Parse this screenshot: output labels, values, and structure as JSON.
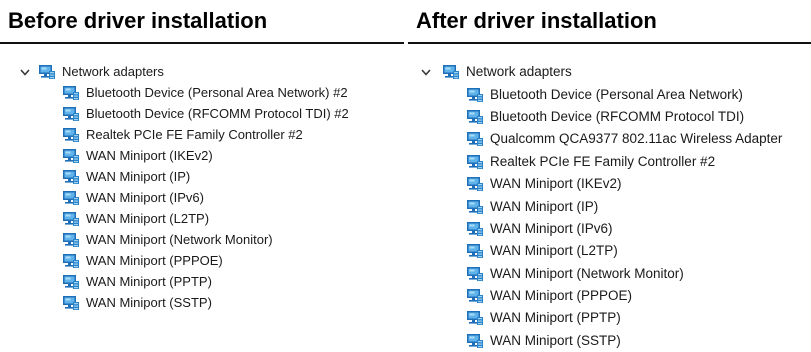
{
  "before": {
    "heading": "Before driver installation",
    "root_label": "Network adapters",
    "items": [
      "Bluetooth Device (Personal Area Network) #2",
      "Bluetooth Device (RFCOMM Protocol TDI) #2",
      "Realtek PCIe FE Family Controller #2",
      "WAN Miniport (IKEv2)",
      "WAN Miniport (IP)",
      "WAN Miniport (IPv6)",
      "WAN Miniport (L2TP)",
      "WAN Miniport (Network Monitor)",
      "WAN Miniport (PPPOE)",
      "WAN Miniport (PPTP)",
      "WAN Miniport (SSTP)"
    ]
  },
  "after": {
    "heading": "After driver installation",
    "root_label": "Network adapters",
    "items": [
      "Bluetooth Device (Personal Area Network)",
      "Bluetooth Device (RFCOMM Protocol TDI)",
      "Qualcomm QCA9377 802.11ac Wireless Adapter",
      "Realtek PCIe FE Family Controller #2",
      "WAN Miniport (IKEv2)",
      "WAN Miniport (IP)",
      "WAN Miniport (IPv6)",
      "WAN Miniport (L2TP)",
      "WAN Miniport (Network Monitor)",
      "WAN Miniport (PPPOE)",
      "WAN Miniport (PPTP)",
      "WAN Miniport (SSTP)"
    ]
  },
  "icons": {
    "expand": "chevron-down-icon",
    "adapter": "network-adapter-icon"
  },
  "colors": {
    "monitor_frame": "#1f6fb8",
    "monitor_screen": "#5fb3ea",
    "rule": "#111111"
  }
}
